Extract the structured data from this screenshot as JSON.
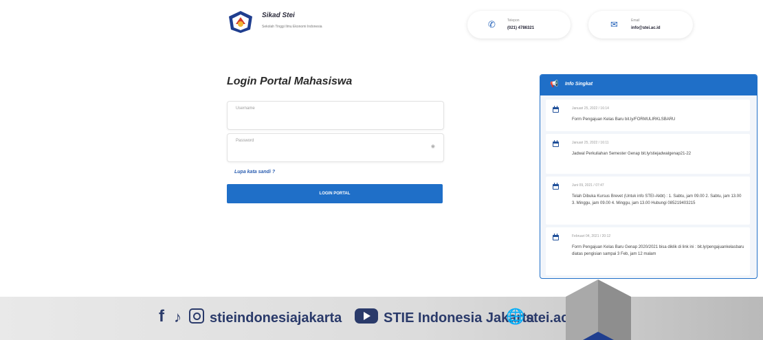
{
  "header": {
    "brand_title": "Sikad Stei",
    "brand_subtitle": "Sekolah Tinggi Ilmu Ekonomi Indonesia",
    "phone_label": "Telepon",
    "phone_value": "(021) 4786321",
    "email_label": "Email",
    "email_value": "info@stei.ac.id"
  },
  "login": {
    "title": "Login Portal Mahasiswa",
    "username_placeholder": "Username",
    "password_placeholder": "Password",
    "forgot": "Lupa kata sandi ?",
    "button": "LOGIN PORTAL"
  },
  "info": {
    "title": "Info Singkat",
    "items": [
      {
        "date": "Januari 25, 2022 / 16:14",
        "text": "Form Pengajuan Kelas Baru bit.ly/FORMULIRKLSBARU"
      },
      {
        "date": "Januari 25, 2022 / 16:11",
        "text": "Jadwal Perkuliahan Semester Genap bit.ly/stiejadwalgenap21-22"
      },
      {
        "date": "Juni 09, 2021 / 07:47",
        "text": "Telah Dibuka Kursus Brevet (Untuk info STEI-Akbt) : 1. Sabtu, jam 09.00 2. Sabtu, jam 13.00 3. Minggu, jam 09.00 4. Minggu, jam 13.00 Hubungi 085219403215"
      },
      {
        "date": "Februari 04, 2021 / 20:12",
        "text": "Form Pengajuan Kelas Baru Genap 2020/2021 bisa diklik di link ini : bit.ly/pengajuankelasbaru diatas pengisian sampai 3 Feb, jam 12 malam"
      }
    ]
  },
  "footer": {
    "instagram": "stieindonesiajakarta",
    "youtube": "STIE Indonesia Jakarta",
    "website": "stei.ac.id"
  },
  "colors": {
    "accent": "#1f6fc8",
    "footer_text": "#2a3a6a"
  },
  "icons": [
    "phone-icon",
    "mail-icon",
    "eye-icon",
    "megaphone-icon",
    "calendar-icon",
    "facebook-icon",
    "tiktok-icon",
    "instagram-icon",
    "youtube-icon",
    "globe-icon"
  ]
}
